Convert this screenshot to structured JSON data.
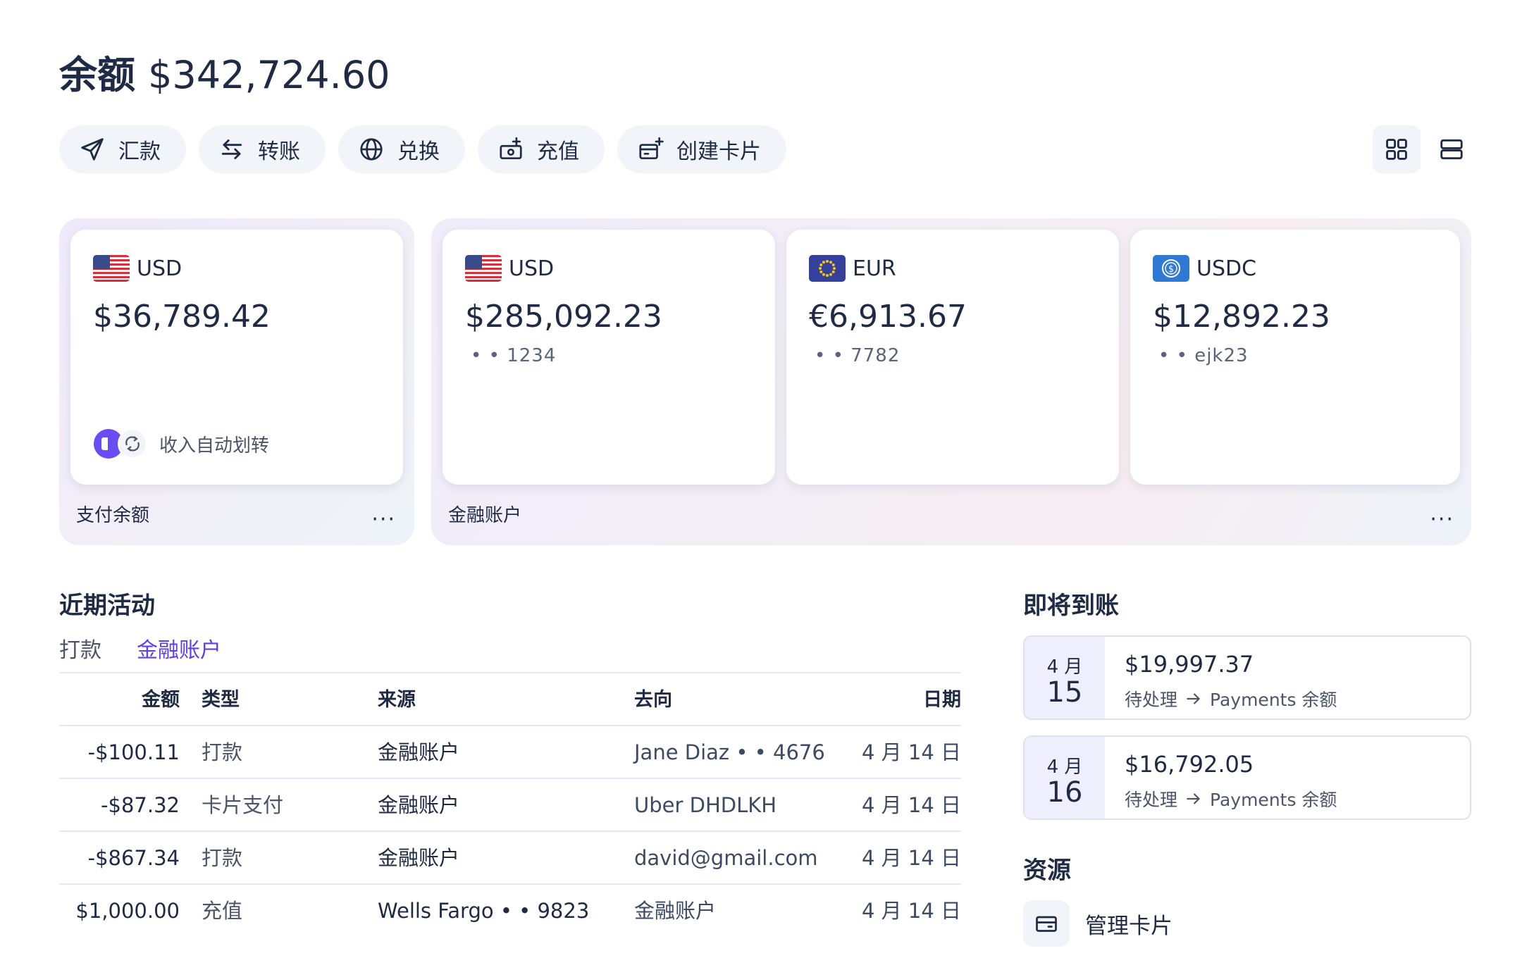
{
  "header": {
    "title_label": "余额",
    "title_amount": "$342,724.60"
  },
  "actions": [
    {
      "label": "汇款",
      "icon": "send-icon"
    },
    {
      "label": "转账",
      "icon": "transfer-arrows-icon"
    },
    {
      "label": "兑换",
      "icon": "globe-icon"
    },
    {
      "label": "充值",
      "icon": "top-up-icon"
    },
    {
      "label": "创建卡片",
      "icon": "create-card-icon"
    }
  ],
  "view_toggle": {
    "active": "grid",
    "options": [
      "grid-view-icon",
      "list-view-icon"
    ]
  },
  "payments_group": {
    "label": "支付余额",
    "more": "···",
    "card": {
      "currency": "USD",
      "amount": "$36,789.42",
      "auto_label": "收入自动划转",
      "flag_icon": "us-flag-icon"
    }
  },
  "financial_group": {
    "label": "金融账户",
    "more": "···",
    "cards": [
      {
        "currency": "USD",
        "amount": "$285,092.23",
        "masked": "• • 1234",
        "flag_icon": "us-flag-icon"
      },
      {
        "currency": "EUR",
        "amount": "€6,913.67",
        "masked": "• • 7782",
        "flag_icon": "eu-flag-icon"
      },
      {
        "currency": "USDC",
        "amount": "$12,892.23",
        "masked": "• • ejk23",
        "flag_icon": "usdc-icon"
      }
    ]
  },
  "recent_activity": {
    "title": "近期活动",
    "tabs": [
      {
        "label": "打款",
        "active": false
      },
      {
        "label": "金融账户",
        "active": true
      }
    ],
    "columns": {
      "amount": "金额",
      "type": "类型",
      "source": "来源",
      "destination": "去向",
      "date": "日期"
    },
    "rows": [
      {
        "amount": "-$100.11",
        "type": "打款",
        "source": "金融账户",
        "destination": "Jane Diaz • • 4676",
        "date": "4 月 14 日"
      },
      {
        "amount": "-$87.32",
        "type": "卡片支付",
        "source": "金融账户",
        "destination": "Uber DHDLKH",
        "date": "4 月 14 日"
      },
      {
        "amount": "-$867.34",
        "type": "打款",
        "source": "金融账户",
        "destination": "david@gmail.com",
        "date": "4 月 14 日"
      },
      {
        "amount": "$1,000.00",
        "type": "充值",
        "source": "Wells Fargo • • 9823",
        "destination": "金融账户",
        "date": "4 月 14 日"
      }
    ]
  },
  "upcoming": {
    "title": "即将到账",
    "items": [
      {
        "month": "4 月",
        "day": "15",
        "amount": "$19,997.37",
        "status": "待处理",
        "target": "Payments 余额"
      },
      {
        "month": "4 月",
        "day": "16",
        "amount": "$16,792.05",
        "status": "待处理",
        "target": "Payments 余额"
      }
    ]
  },
  "resources": {
    "title": "资源",
    "items": [
      {
        "label": "管理卡片",
        "icon": "card-icon"
      }
    ]
  },
  "colors": {
    "text": "#1f2a44",
    "accent": "#5b3df5",
    "muted": "#4a5568",
    "button_bg": "#f1f4f8"
  }
}
